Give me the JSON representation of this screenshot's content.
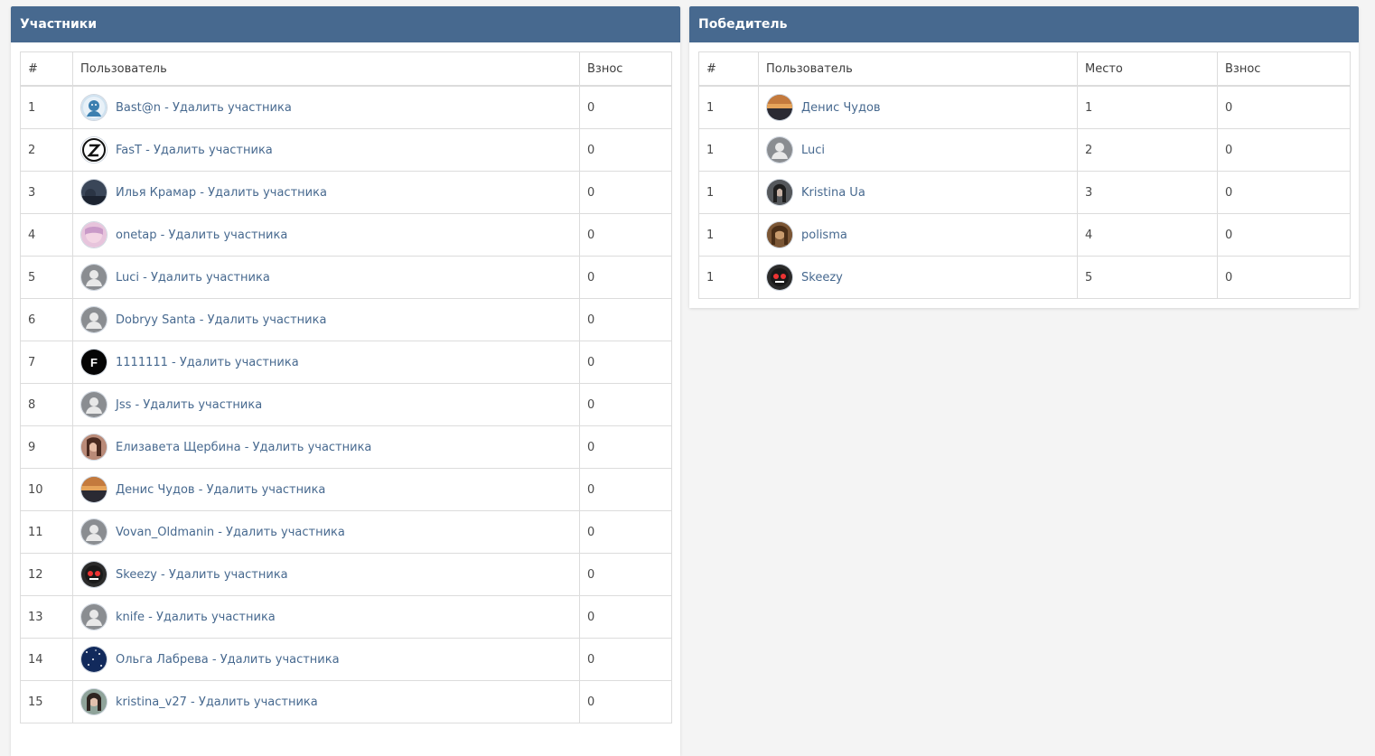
{
  "participants_panel": {
    "title": "Участники",
    "columns": [
      "#",
      "Пользователь",
      "Взнос"
    ],
    "separator": " - ",
    "delete_label": "Удалить участника",
    "rows": [
      {
        "num": "1",
        "user": "Bast@n",
        "fee": "0",
        "avatar": "blue-portrait"
      },
      {
        "num": "2",
        "user": "FasT",
        "fee": "0",
        "avatar": "z-logo"
      },
      {
        "num": "3",
        "user": "Илья Крамар",
        "fee": "0",
        "avatar": "dark-photo"
      },
      {
        "num": "4",
        "user": "onetap",
        "fee": "0",
        "avatar": "pink-anime"
      },
      {
        "num": "5",
        "user": "Luci",
        "fee": "0",
        "avatar": "default-user"
      },
      {
        "num": "6",
        "user": "Dobryy Santa",
        "fee": "0",
        "avatar": "default-user"
      },
      {
        "num": "7",
        "user": "1111111",
        "fee": "0",
        "avatar": "f-logo"
      },
      {
        "num": "8",
        "user": "Jss",
        "fee": "0",
        "avatar": "default-user"
      },
      {
        "num": "9",
        "user": "Елизавета Щербина",
        "fee": "0",
        "avatar": "woman-photo"
      },
      {
        "num": "10",
        "user": "Денис Чудов",
        "fee": "0",
        "avatar": "sunset-photo"
      },
      {
        "num": "11",
        "user": "Vovan_Oldmanin",
        "fee": "0",
        "avatar": "default-user"
      },
      {
        "num": "12",
        "user": "Skeezy",
        "fee": "0",
        "avatar": "mask-photo"
      },
      {
        "num": "13",
        "user": "knife",
        "fee": "0",
        "avatar": "default-user"
      },
      {
        "num": "14",
        "user": "Ольга Лабрева",
        "fee": "0",
        "avatar": "stars-photo"
      },
      {
        "num": "15",
        "user": "kristina_v27",
        "fee": "0",
        "avatar": "girl-photo"
      }
    ]
  },
  "winner_panel": {
    "title": "Победитель",
    "columns": [
      "#",
      "Пользователь",
      "Место",
      "Взнос"
    ],
    "rows": [
      {
        "num": "1",
        "user": "Денис Чудов",
        "place": "1",
        "fee": "0",
        "avatar": "sunset-photo"
      },
      {
        "num": "1",
        "user": "Luci",
        "place": "2",
        "fee": "0",
        "avatar": "default-user"
      },
      {
        "num": "1",
        "user": "Kristina Ua",
        "place": "3",
        "fee": "0",
        "avatar": "dark-hair-photo"
      },
      {
        "num": "1",
        "user": "polisma",
        "place": "4",
        "fee": "0",
        "avatar": "brown-photo"
      },
      {
        "num": "1",
        "user": "Skeezy",
        "place": "5",
        "fee": "0",
        "avatar": "mask-photo"
      }
    ]
  },
  "colors": {
    "header_bg": "#47698f",
    "link": "#47698f",
    "page_bg": "#f4f4f4",
    "border": "#dcdcdc"
  }
}
